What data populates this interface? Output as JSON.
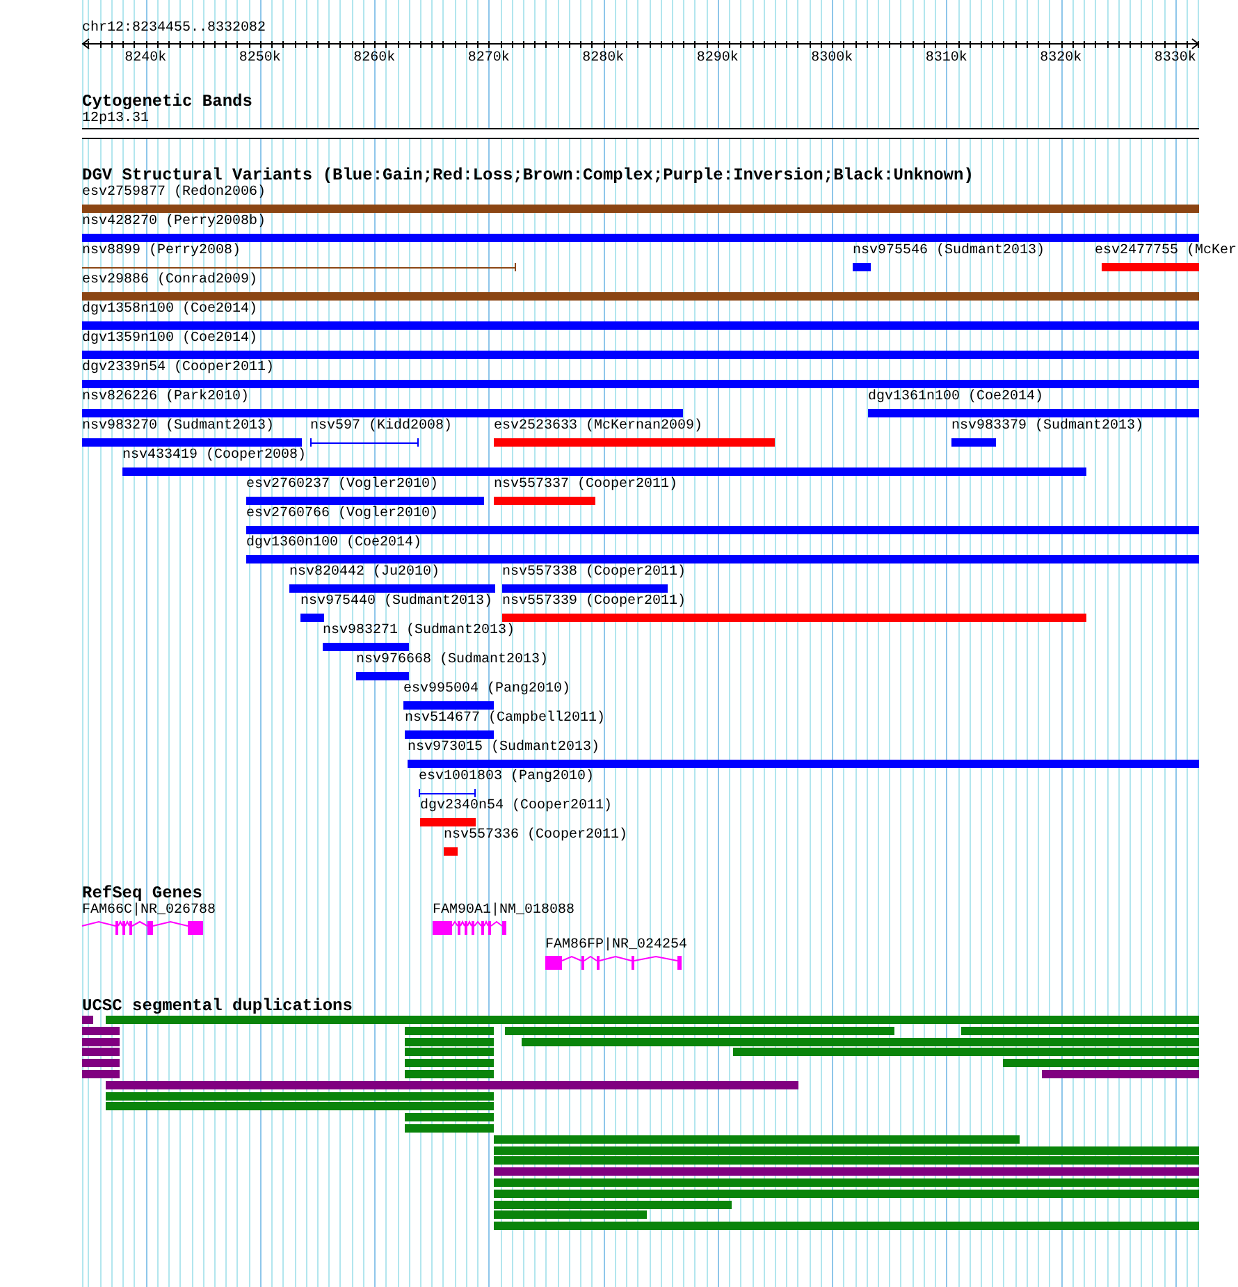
{
  "browser": {
    "position": "chr12:8234455..8332082",
    "ruler": {
      "ticks": [
        "8240k",
        "8250k",
        "8260k",
        "8270k",
        "8280k",
        "8290k",
        "8300k",
        "8310k",
        "8320k",
        "8330k"
      ]
    },
    "tracks": [
      {
        "kind": "cytoband",
        "title": "Cytogenetic Bands",
        "bands": [
          {
            "label": "12p13.31"
          }
        ]
      },
      {
        "kind": "variants",
        "title": "DGV Structural Variants (Blue:Gain;Red:Loss;Brown:Complex;Purple:Inversion;Black:Unknown)",
        "rows": [
          {
            "items": [
              {
                "label": "esv2759877 (Redon2006)",
                "color": "#8b4513",
                "kind": "bar"
              }
            ]
          },
          {
            "items": [
              {
                "label": "nsv428270 (Perry2008b)",
                "color": "#0000ff",
                "kind": "bar"
              }
            ]
          },
          {
            "items": [
              {
                "label": "nsv8899 (Perry2008)",
                "color": "#8b4513",
                "kind": "line"
              },
              {
                "label": "nsv975546 (Sudmant2013)",
                "color": "#0000ff",
                "kind": "bar"
              },
              {
                "label": "esv2477755 (McKer",
                "color": "#ff0000",
                "kind": "bar"
              }
            ]
          },
          {
            "items": [
              {
                "label": "esv29886 (Conrad2009)",
                "color": "#8b4513",
                "kind": "bar"
              }
            ]
          },
          {
            "items": [
              {
                "label": "dgv1358n100 (Coe2014)",
                "color": "#0000ff",
                "kind": "bar"
              }
            ]
          },
          {
            "items": [
              {
                "label": "dgv1359n100 (Coe2014)",
                "color": "#0000ff",
                "kind": "bar"
              }
            ]
          },
          {
            "items": [
              {
                "label": "dgv2339n54 (Cooper2011)",
                "color": "#0000ff",
                "kind": "bar"
              }
            ]
          },
          {
            "items": [
              {
                "label": "nsv826226 (Park2010)",
                "color": "#0000ff",
                "kind": "bar"
              },
              {
                "label": "dgv1361n100 (Coe2014)",
                "color": "#0000ff",
                "kind": "bar"
              }
            ]
          },
          {
            "items": [
              {
                "label": "nsv983270 (Sudmant2013)",
                "color": "#0000ff",
                "kind": "bar"
              },
              {
                "label": "nsv597 (Kidd2008)",
                "color": "#0000ff",
                "kind": "line"
              },
              {
                "label": "esv2523633 (McKernan2009)",
                "color": "#ff0000",
                "kind": "bar"
              },
              {
                "label": "nsv983379 (Sudmant2013)",
                "color": "#0000ff",
                "kind": "bar"
              }
            ]
          },
          {
            "items": [
              {
                "label": "nsv433419 (Cooper2008)",
                "color": "#0000ff",
                "kind": "bar"
              }
            ]
          },
          {
            "items": [
              {
                "label": "esv2760237 (Vogler2010)",
                "color": "#0000ff",
                "kind": "bar"
              },
              {
                "label": "nsv557337 (Cooper2011)",
                "color": "#ff0000",
                "kind": "bar"
              }
            ]
          },
          {
            "items": [
              {
                "label": "esv2760766 (Vogler2010)",
                "color": "#0000ff",
                "kind": "bar"
              }
            ]
          },
          {
            "items": [
              {
                "label": "dgv1360n100 (Coe2014)",
                "color": "#0000ff",
                "kind": "bar"
              }
            ]
          },
          {
            "items": [
              {
                "label": "nsv820442 (Ju2010)",
                "color": "#0000ff",
                "kind": "bar"
              },
              {
                "label": "nsv557338 (Cooper2011)",
                "color": "#0000ff",
                "kind": "bar"
              }
            ]
          },
          {
            "items": [
              {
                "label": "nsv975440 (Sudmant2013)",
                "color": "#0000ff",
                "kind": "bar"
              },
              {
                "label": "nsv557339 (Cooper2011)",
                "color": "#ff0000",
                "kind": "bar"
              }
            ]
          },
          {
            "items": [
              {
                "label": "nsv983271 (Sudmant2013)",
                "color": "#0000ff",
                "kind": "bar"
              }
            ]
          },
          {
            "items": [
              {
                "label": "nsv976668 (Sudmant2013)",
                "color": "#0000ff",
                "kind": "bar"
              }
            ]
          },
          {
            "items": [
              {
                "label": "esv995004 (Pang2010)",
                "color": "#0000ff",
                "kind": "bar"
              }
            ]
          },
          {
            "items": [
              {
                "label": "nsv514677 (Campbell2011)",
                "color": "#0000ff",
                "kind": "bar"
              }
            ]
          },
          {
            "items": [
              {
                "label": "nsv973015 (Sudmant2013)",
                "color": "#0000ff",
                "kind": "bar"
              }
            ]
          },
          {
            "items": [
              {
                "label": "esv1001803 (Pang2010)",
                "color": "#0000ff",
                "kind": "line"
              }
            ]
          },
          {
            "items": [
              {
                "label": "dgv2340n54 (Cooper2011)",
                "color": "#ff0000",
                "kind": "bar"
              }
            ]
          },
          {
            "items": [
              {
                "label": "nsv557336 (Cooper2011)",
                "color": "#ff0000",
                "kind": "bar"
              }
            ]
          }
        ]
      },
      {
        "kind": "genes",
        "title": "RefSeq Genes",
        "rows": [
          {
            "items": [
              {
                "label": "FAM66C|NR_026788"
              },
              {
                "label": "FAM90A1|NM_018088"
              }
            ]
          },
          {
            "items": [
              {
                "label": "FAM86FP|NR_024254"
              }
            ]
          }
        ]
      },
      {
        "kind": "segments",
        "title": "UCSC segmental duplications",
        "rows": [
          {
            "items": [
              {
                "color": "#800080"
              },
              {
                "color": "#0a840a"
              }
            ]
          },
          {
            "items": [
              {
                "color": "#800080"
              },
              {
                "color": "#0a840a"
              },
              {
                "color": "#0a840a"
              },
              {
                "color": "#0a840a"
              }
            ]
          },
          {
            "items": [
              {
                "color": "#800080"
              },
              {
                "color": "#0a840a"
              },
              {
                "color": "#0a840a"
              }
            ]
          },
          {
            "items": [
              {
                "color": "#800080"
              },
              {
                "color": "#0a840a"
              },
              {
                "color": "#0a840a"
              }
            ]
          },
          {
            "items": [
              {
                "color": "#800080"
              },
              {
                "color": "#0a840a"
              },
              {
                "color": "#0a840a"
              }
            ]
          },
          {
            "items": [
              {
                "color": "#800080"
              },
              {
                "color": "#0a840a"
              },
              {
                "color": "#800080"
              }
            ]
          },
          {
            "items": [
              {
                "color": "#800080"
              }
            ]
          },
          {
            "items": [
              {
                "color": "#0a840a"
              }
            ]
          },
          {
            "items": [
              {
                "color": "#0a840a"
              }
            ]
          },
          {
            "items": [
              {
                "color": "#0a840a"
              }
            ]
          },
          {
            "items": [
              {
                "color": "#0a840a"
              }
            ]
          },
          {
            "items": [
              {
                "color": "#0a840a"
              }
            ]
          },
          {
            "items": [
              {
                "color": "#0a840a"
              }
            ]
          },
          {
            "items": [
              {
                "color": "#0a840a"
              }
            ]
          },
          {
            "items": [
              {
                "color": "#800080"
              }
            ]
          },
          {
            "items": [
              {
                "color": "#0a840a"
              }
            ]
          },
          {
            "items": [
              {
                "color": "#0a840a"
              }
            ]
          },
          {
            "items": [
              {
                "color": "#0a840a"
              }
            ]
          },
          {
            "items": [
              {
                "color": "#0a840a"
              }
            ]
          },
          {
            "items": [
              {
                "color": "#0a840a"
              }
            ]
          }
        ]
      }
    ]
  }
}
